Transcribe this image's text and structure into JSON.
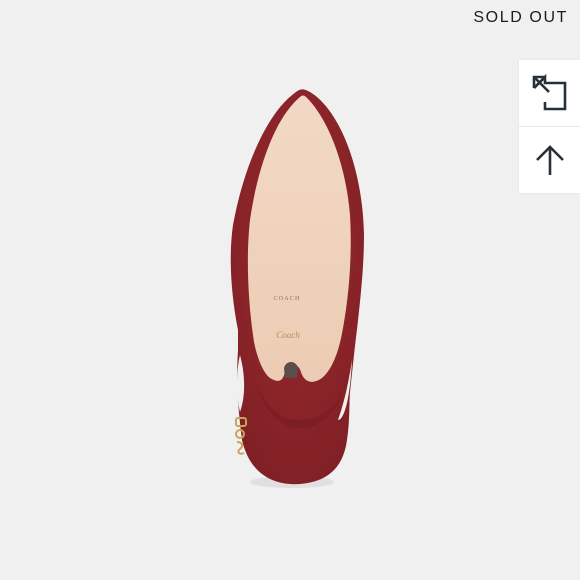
{
  "status": {
    "sold_out_label": "SOLD OUT"
  },
  "side_actions": [
    {
      "icon": "share-icon"
    },
    {
      "icon": "arrow-up-icon"
    }
  ],
  "product_image": {
    "sole_brand_text": "COACH",
    "sole_logo_text": "Coach"
  },
  "colors": {
    "background": "#f0f0f0",
    "suede": "#8b2328",
    "suede_dark": "#6e1a1f",
    "sole": "#f0d3bd",
    "buckle": "#c8a35a",
    "icon": "#263238"
  }
}
